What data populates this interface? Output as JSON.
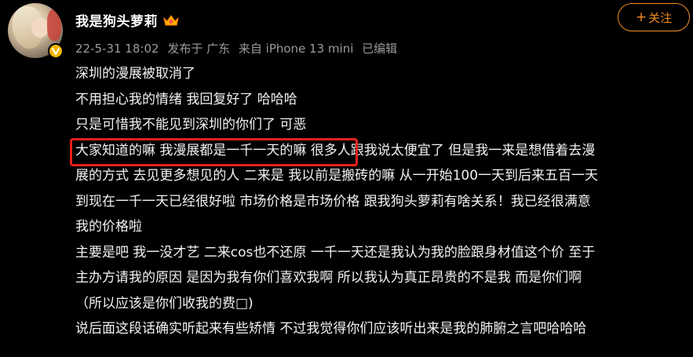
{
  "user": {
    "name": "我是狗头萝莉",
    "avatar_icon": "user-avatar",
    "verified_icon": "verified-v-badge",
    "level_icon": "crown-badge-icon"
  },
  "meta": {
    "date": "22-5-31 18:02",
    "location": "发布于 广东",
    "source": "来自 iPhone 13 mini",
    "edited": "已编辑"
  },
  "follow": {
    "plus": "+",
    "label": "关注"
  },
  "post": {
    "lines": [
      "深圳的漫展被取消了",
      "不用担心我的情绪 我回复好了 哈哈哈",
      "只是可惜我不能见到深圳的你们了 可恶",
      "大家知道的嘛 我漫展都是一千一天的嘛 很多人跟我说太便宜了 但是我一来是想借着去漫",
      "展的方式 去见更多想见的人 二来是 我以前是搬砖的嘛 从一开始100一天到后来五百一天",
      "到现在一千一天已经很好啦 市场价格是市场价格 跟我狗头萝莉有啥关系！我已经很满意",
      "我的价格啦",
      "主要是吧 我一没才艺 二来cos也不还原 一千一天还是我认为我的脸跟身材值这个价 至于",
      "主办方请我的原因 是因为我有你们喜欢我啊 所以我认为真正昂贵的不是我 而是你们啊",
      "（所以应该是你们收我的费□)",
      "说后面这段话确实听起来有些矫情 不过我觉得你们应该听出来是我的肺腑之言吧哈哈哈"
    ]
  },
  "colors": {
    "background": "#000000",
    "text": "#f2f2f2",
    "meta": "#9a9a9a",
    "accent": "#f08a24",
    "highlight": "#e8201b",
    "verified": "#f2b600"
  }
}
